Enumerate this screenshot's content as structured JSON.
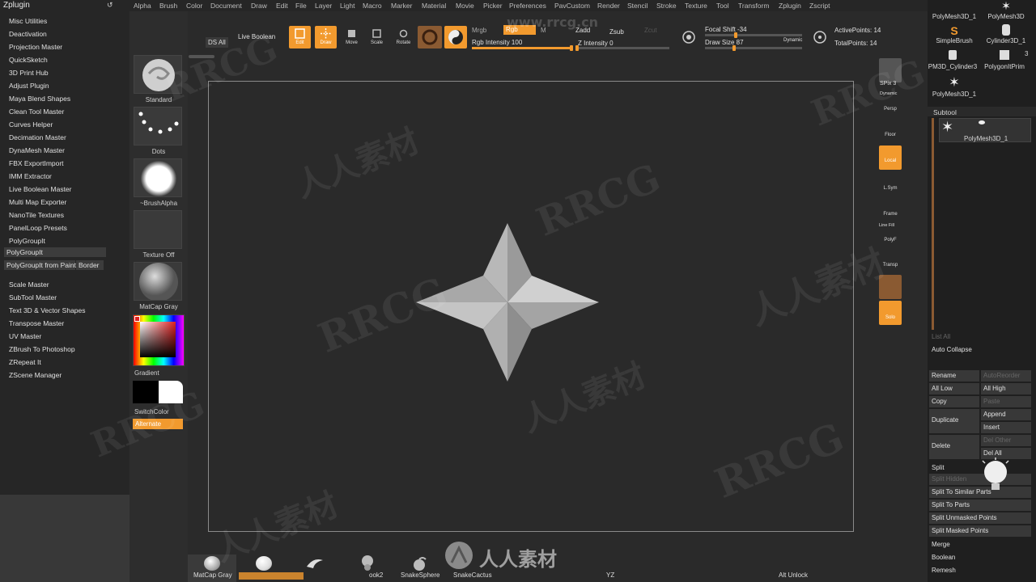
{
  "menu": {
    "zplugin_title": "Zplugin",
    "items": [
      "Alpha",
      "Brush",
      "Color",
      "Document",
      "Draw",
      "Edit",
      "File",
      "Layer",
      "Light",
      "Macro",
      "Marker",
      "Material",
      "Movie",
      "Picker",
      "Preferences",
      "PavCustom",
      "Render",
      "Stencil",
      "Stroke",
      "Texture",
      "Tool",
      "Transform",
      "Zplugin",
      "Zscript"
    ]
  },
  "plugin_panel": {
    "items": [
      "Misc Utilities",
      "Deactivation",
      "Projection Master",
      "QuickSketch",
      "3D Print Hub",
      "Adjust Plugin",
      "Maya Blend Shapes",
      "Clean Tool Master",
      "Curves Helper",
      "Decimation Master",
      "DynaMesh Master",
      "FBX ExportImport",
      "IMM Extractor",
      "Live Boolean Master",
      "Multi Map Exporter",
      "NanoTile Textures",
      "PanelLoop Presets",
      "PolyGroupIt"
    ],
    "polygroupit_btn": "PolyGroupIt",
    "polygroupit_paint": "PolyGroupIt from Paint",
    "border": "Border",
    "items2": [
      "Scale Master",
      "SubTool Master",
      "Text 3D & Vector Shapes",
      "Transpose Master",
      "UV Master",
      "ZBrush To Photoshop",
      "ZRepeat It",
      "ZScene Manager"
    ]
  },
  "left_shelf": {
    "standard": "Standard",
    "dots": "Dots",
    "brush_alpha": "~BrushAlpha",
    "texture_off": "Texture Off",
    "matcap": "MatCap Gray",
    "gradient": "Gradient",
    "switch_color": "SwitchColor",
    "alternate": "Alternate"
  },
  "toolbar": {
    "ds_all": "DS All",
    "live_boolean": "Live Boolean",
    "edit": "Edit",
    "draw": "Draw",
    "move": "Move",
    "scale": "Scale",
    "rotate": "Rotate",
    "mrgb": "Mrgb",
    "rgb": "Rgb",
    "m": "M",
    "rgb_intensity": "Rgb Intensity 100",
    "zadd": "Zadd",
    "zsub": "Zsub",
    "zcut": "Zcut",
    "z_intensity": "Z Intensity 0",
    "focal_shift": "Focal Shift -34",
    "draw_size": "Draw Size 87",
    "dynamic": "Dynamic",
    "active_points": "ActivePoints: 14",
    "total_points": "TotalPoints: 14",
    "rgb_intensity_value": 100,
    "z_intensity_value": 0
  },
  "right_shelf": {
    "spix": "SPix 3",
    "dynamic": "Dynamic",
    "persp": "Persp",
    "floor": "Floor",
    "local": "Local",
    "lsym": "L.Sym",
    "frame": "Frame",
    "line_fill": "Line Fill",
    "polyf": "PolyF",
    "transp": "Transp",
    "solo": "Solo"
  },
  "tool_panel": {
    "top_thumbs": [
      "PolyMesh3D_1",
      "PolyMesh3D",
      "SimpleBrush",
      "Cylinder3D_1",
      "PM3D_Cylinder3",
      "PolygonItPrim",
      "PolyMesh3D_1"
    ],
    "count_badge": "3",
    "subtool_header": "Subtool",
    "subtool_name": "PolyMesh3D_1",
    "list_all": "List All",
    "auto_collapse": "Auto Collapse",
    "rename": "Rename",
    "auto_reorder": "AutoReorder",
    "all_low": "All Low",
    "all_high": "All High",
    "copy": "Copy",
    "paste": "Paste",
    "duplicate": "Duplicate",
    "append": "Append",
    "insert": "Insert",
    "delete": "Delete",
    "del_other": "Del Other",
    "del_all": "Del All",
    "split": "Split",
    "split_hidden": "Split Hidden",
    "split_similar": "Split To Similar Parts",
    "split_parts": "Split To Parts",
    "split_unmasked": "Split Unmasked Points",
    "split_masked": "Split Masked Points",
    "merge": "Merge",
    "boolean": "Boolean",
    "remesh": "Remesh"
  },
  "bottom_shelf": {
    "matcap_gray": "MatCap Gray",
    "hook2": "ook2",
    "snake_sphere": "SnakeSphere",
    "snake_cactus": "SnakeCactus",
    "yz": "YZ",
    "alt_unlock": "Alt Unlock"
  },
  "watermark": {
    "rrcg": "RRCG",
    "cn": "人人素材",
    "site": "www.rrcg.cn"
  },
  "colors": {
    "accent": "#f29a2e",
    "panel": "#262626",
    "canvas": "#2a2a2a"
  }
}
